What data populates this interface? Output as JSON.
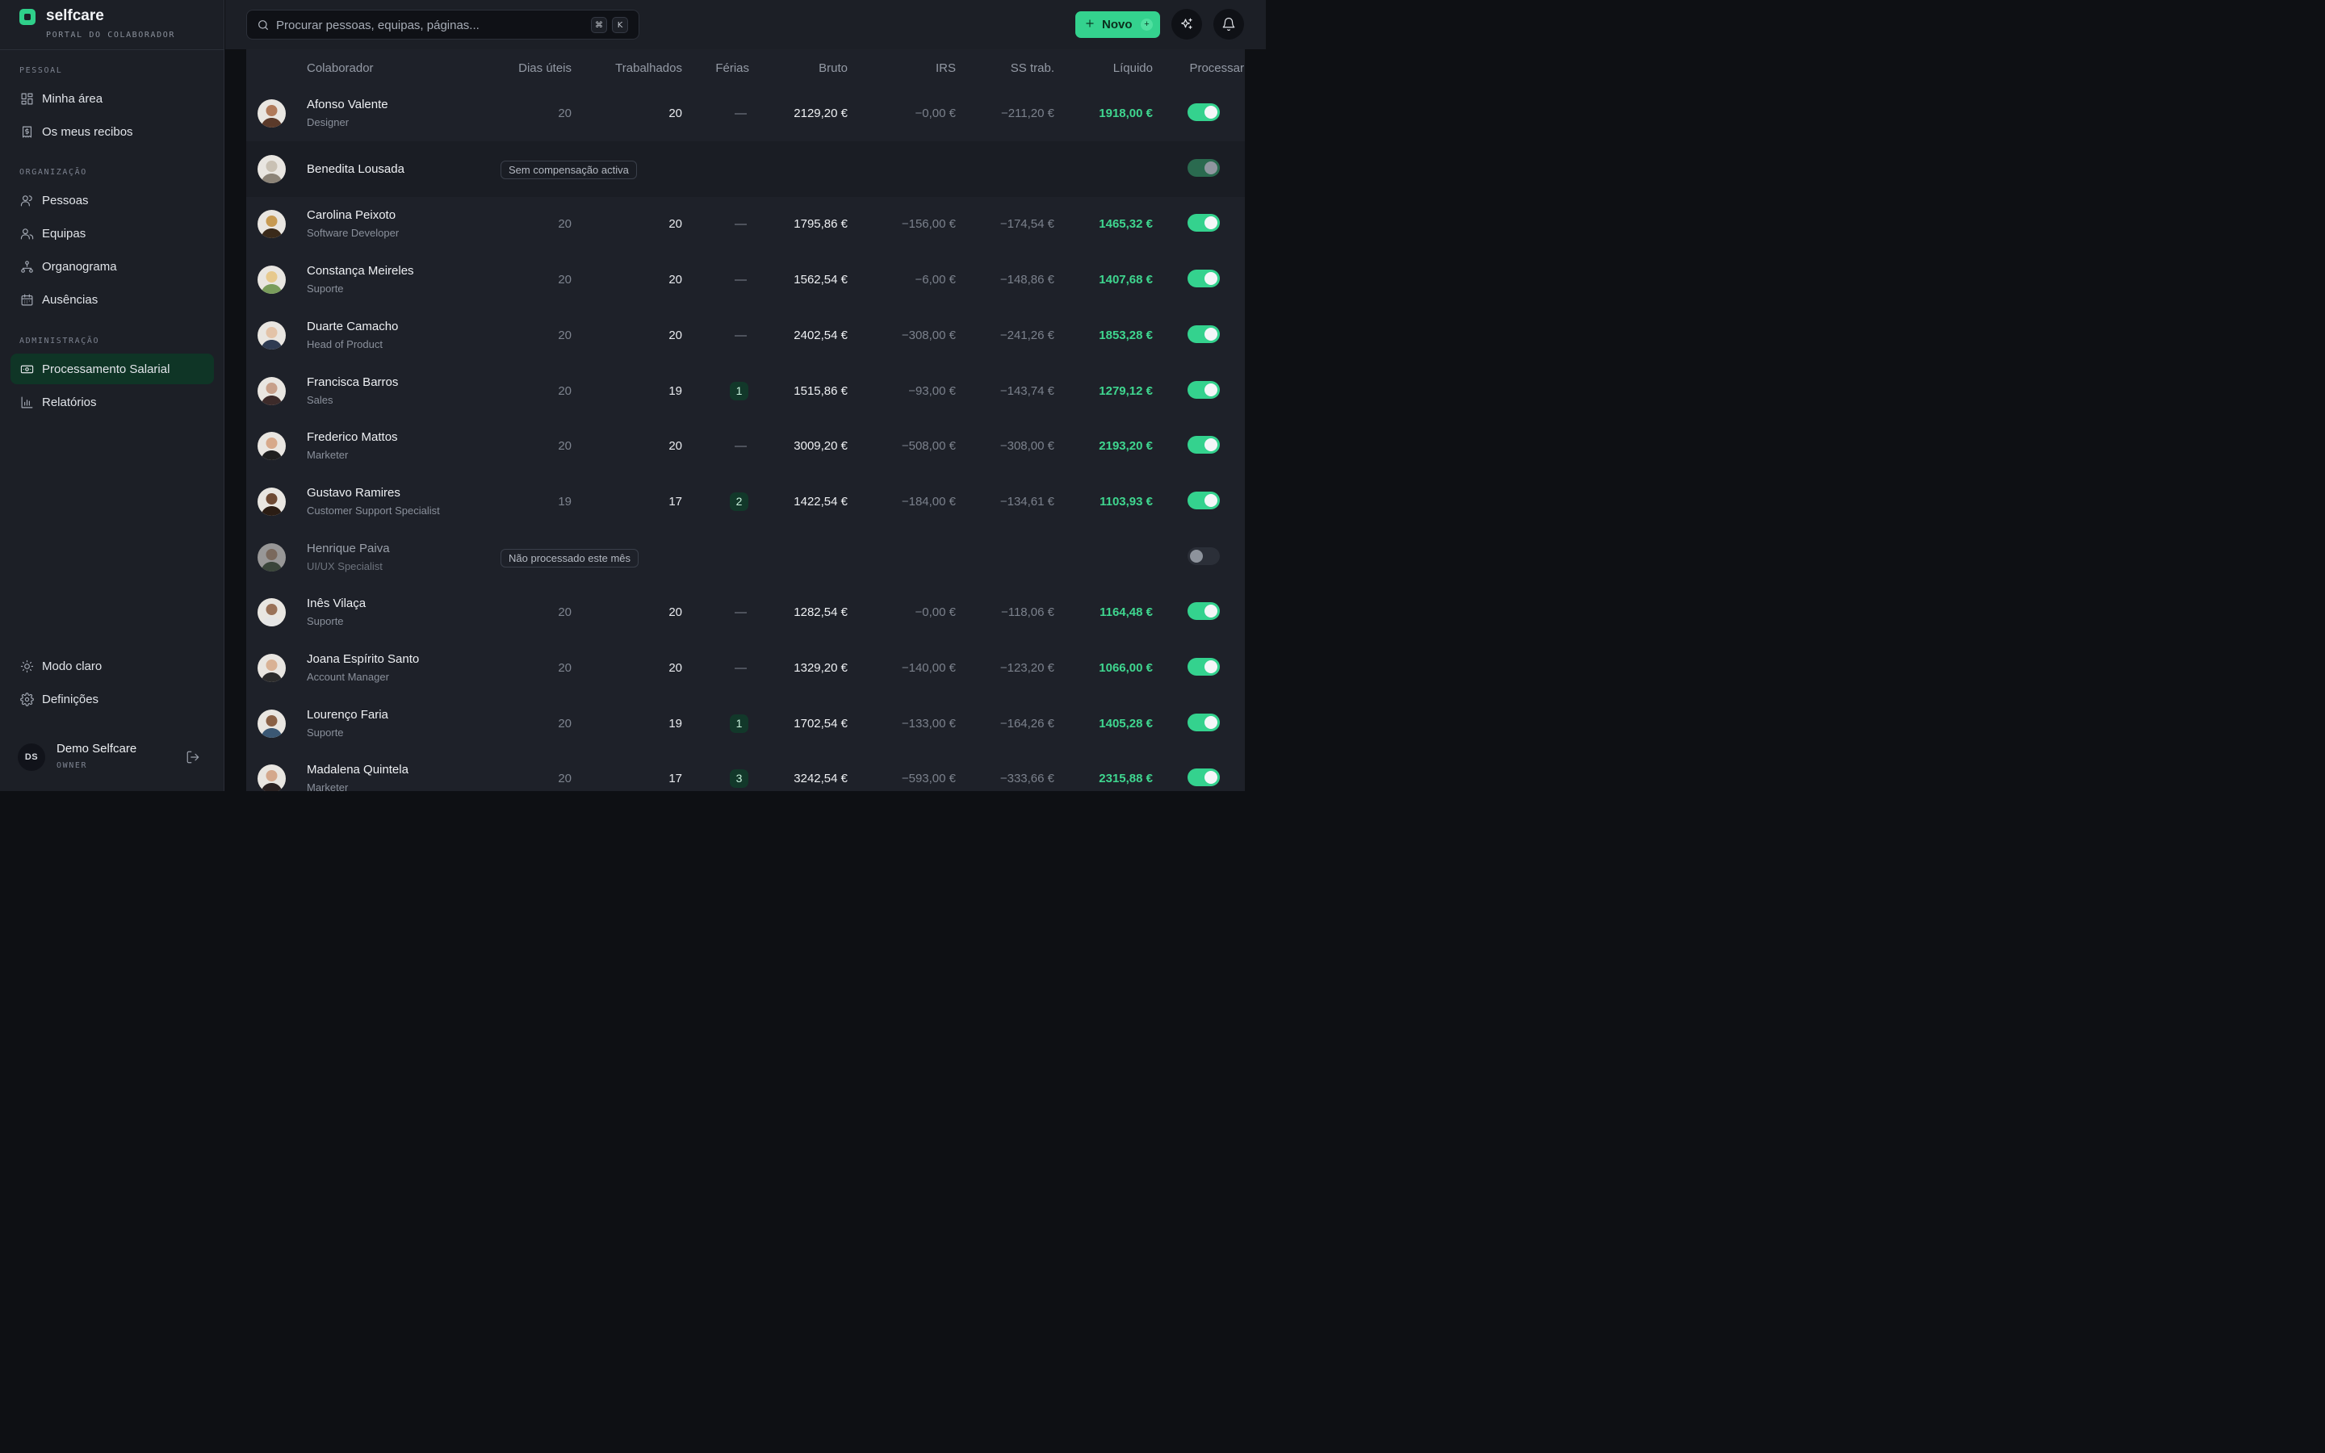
{
  "brand": {
    "name": "selfcare",
    "subtitle": "PORTAL DO COLABORADOR"
  },
  "sidebar": {
    "sections": [
      {
        "label": "PESSOAL",
        "items": [
          {
            "label": "Minha área",
            "icon": "dashboard-icon"
          },
          {
            "label": "Os meus recibos",
            "icon": "receipt-icon"
          }
        ]
      },
      {
        "label": "ORGANIZAÇÃO",
        "items": [
          {
            "label": "Pessoas",
            "icon": "user-icon"
          },
          {
            "label": "Equipas",
            "icon": "users-icon"
          },
          {
            "label": "Organograma",
            "icon": "org-chart-icon"
          },
          {
            "label": "Ausências",
            "icon": "calendar-icon"
          }
        ]
      },
      {
        "label": "ADMINISTRAÇÃO",
        "items": [
          {
            "label": "Processamento Salarial",
            "icon": "banknote-icon",
            "active": true
          },
          {
            "label": "Relatórios",
            "icon": "bar-chart-icon"
          }
        ]
      }
    ],
    "bottom": [
      {
        "label": "Modo claro",
        "icon": "sun-icon"
      },
      {
        "label": "Definições",
        "icon": "gear-icon"
      }
    ],
    "user": {
      "initials": "DS",
      "name": "Demo Selfcare",
      "role": "OWNER"
    }
  },
  "topbar": {
    "search_placeholder": "Procurar pessoas, equipas, páginas...",
    "shortcut": [
      "⌘",
      "K"
    ],
    "new_button": "Novo",
    "new_button_badge": "+"
  },
  "colors": {
    "accent": "#34d28e",
    "net_pay": "#3fd68f",
    "active_nav": "#0f3526"
  },
  "table": {
    "headers": {
      "colaborador": "Colaborador",
      "dias": "Dias úteis",
      "trabalhados": "Trabalhados",
      "ferias": "Férias",
      "bruto": "Bruto",
      "irs": "IRS",
      "ss": "SS trab.",
      "liquido": "Líquido",
      "processar": "Processar"
    },
    "rows": [
      {
        "name": "Afonso Valente",
        "role": "Designer",
        "dias": "20",
        "trabalhados": "20",
        "ferias": "—",
        "bruto": "2129,20 €",
        "irs": "−0,00 €",
        "ss": "−211,20 €",
        "liquido": "1918,00 €",
        "processar": true
      },
      {
        "name": "Benedita Lousada",
        "role": "",
        "status": "Sem compensação activa",
        "processar": true,
        "disabled": true
      },
      {
        "name": "Carolina Peixoto",
        "role": "Software Developer",
        "dias": "20",
        "trabalhados": "20",
        "ferias": "—",
        "bruto": "1795,86 €",
        "irs": "−156,00 €",
        "ss": "−174,54 €",
        "liquido": "1465,32 €",
        "processar": true
      },
      {
        "name": "Constança Meireles",
        "role": "Suporte",
        "dias": "20",
        "trabalhados": "20",
        "ferias": "—",
        "bruto": "1562,54 €",
        "irs": "−6,00 €",
        "ss": "−148,86 €",
        "liquido": "1407,68 €",
        "processar": true
      },
      {
        "name": "Duarte Camacho",
        "role": "Head of Product",
        "dias": "20",
        "trabalhados": "20",
        "ferias": "—",
        "bruto": "2402,54 €",
        "irs": "−308,00 €",
        "ss": "−241,26 €",
        "liquido": "1853,28 €",
        "processar": true
      },
      {
        "name": "Francisca Barros",
        "role": "Sales",
        "dias": "20",
        "trabalhados": "19",
        "ferias": "1",
        "bruto": "1515,86 €",
        "irs": "−93,00 €",
        "ss": "−143,74 €",
        "liquido": "1279,12 €",
        "processar": true
      },
      {
        "name": "Frederico Mattos",
        "role": "Marketer",
        "dias": "20",
        "trabalhados": "20",
        "ferias": "—",
        "bruto": "3009,20 €",
        "irs": "−508,00 €",
        "ss": "−308,00 €",
        "liquido": "2193,20 €",
        "processar": true
      },
      {
        "name": "Gustavo Ramires",
        "role": "Customer Support Specialist",
        "dias": "19",
        "trabalhados": "17",
        "ferias": "2",
        "bruto": "1422,54 €",
        "irs": "−184,00 €",
        "ss": "−134,61 €",
        "liquido": "1103,93 €",
        "processar": true
      },
      {
        "name": "Henrique Paiva",
        "role": "UI/UX Specialist",
        "status": "Não processado este mês",
        "processar": false,
        "dim": true
      },
      {
        "name": "Inês Vilaça",
        "role": "Suporte",
        "dias": "20",
        "trabalhados": "20",
        "ferias": "—",
        "bruto": "1282,54 €",
        "irs": "−0,00 €",
        "ss": "−118,06 €",
        "liquido": "1164,48 €",
        "processar": true
      },
      {
        "name": "Joana Espírito Santo",
        "role": "Account Manager",
        "dias": "20",
        "trabalhados": "20",
        "ferias": "—",
        "bruto": "1329,20 €",
        "irs": "−140,00 €",
        "ss": "−123,20 €",
        "liquido": "1066,00 €",
        "processar": true
      },
      {
        "name": "Lourenço Faria",
        "role": "Suporte",
        "dias": "20",
        "trabalhados": "19",
        "ferias": "1",
        "bruto": "1702,54 €",
        "irs": "−133,00 €",
        "ss": "−164,26 €",
        "liquido": "1405,28 €",
        "processar": true
      },
      {
        "name": "Madalena Quintela",
        "role": "Marketer",
        "dias": "20",
        "trabalhados": "17",
        "ferias": "3",
        "bruto": "3242,54 €",
        "irs": "−593,00 €",
        "ss": "−333,66 €",
        "liquido": "2315,88 €",
        "processar": true
      }
    ]
  }
}
